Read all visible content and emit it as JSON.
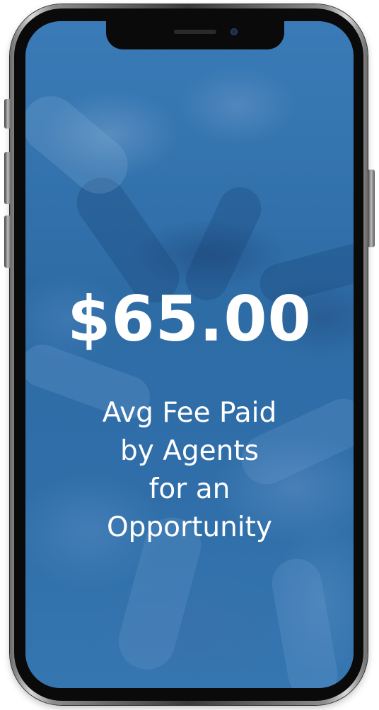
{
  "stat": {
    "amount": "$65.00",
    "caption_lines": [
      "Avg Fee Paid",
      "by Agents",
      "for an",
      "Opportunity"
    ]
  },
  "colors": {
    "screen_background": "#2f6fa8",
    "text": "#ffffff",
    "frame": "#0a0a0a"
  }
}
